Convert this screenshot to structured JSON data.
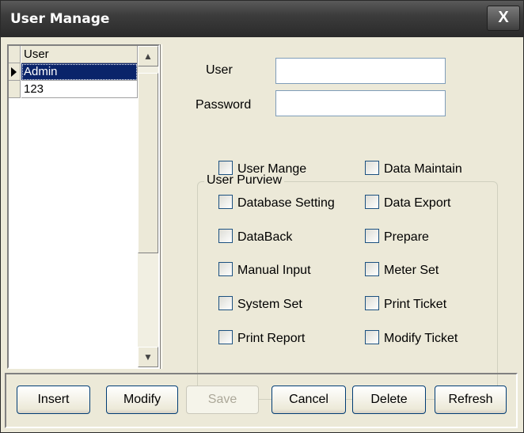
{
  "window": {
    "title": "User Manage",
    "close_glyph": "X"
  },
  "user_list": {
    "header": "User",
    "rows": [
      {
        "name": "Admin",
        "selected": true
      },
      {
        "name": "123",
        "selected": false
      }
    ]
  },
  "form": {
    "user_label": "User",
    "user_value": "",
    "password_label": "Password",
    "password_value": ""
  },
  "purview": {
    "title": "User Purview",
    "left": [
      "User Mange",
      "Database Setting",
      "DataBack",
      "Manual Input",
      "System Set",
      "Print Report"
    ],
    "right": [
      "Data Maintain",
      "Data Export",
      "Prepare",
      "Meter Set",
      "Print Ticket",
      "Modify Ticket"
    ]
  },
  "buttons": {
    "insert": "Insert",
    "modify": "Modify",
    "save": "Save",
    "cancel": "Cancel",
    "delete": "Delete",
    "refresh": "Refresh"
  },
  "icons": {
    "row_indicator": "triangle-right-icon",
    "scroll_up": "arrow-up-icon",
    "scroll_down": "arrow-down-icon"
  }
}
